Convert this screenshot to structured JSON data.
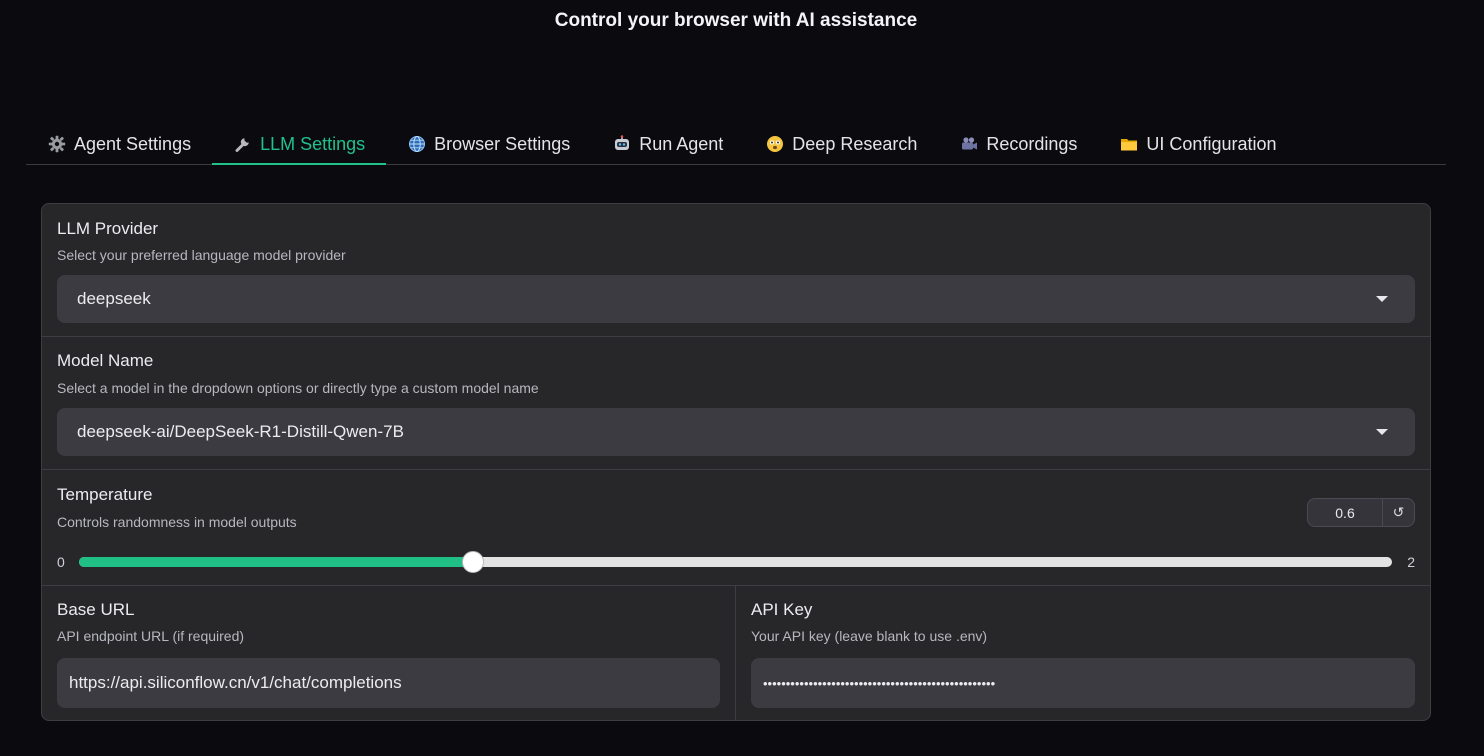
{
  "header": {
    "title": "Control your browser with AI assistance"
  },
  "tabs": [
    {
      "label": "Agent Settings",
      "icon": "gear-icon"
    },
    {
      "label": "LLM Settings",
      "icon": "wrench-icon",
      "active": true
    },
    {
      "label": "Browser Settings",
      "icon": "globe-icon"
    },
    {
      "label": "Run Agent",
      "icon": "robot-icon"
    },
    {
      "label": "Deep Research",
      "icon": "face-icon"
    },
    {
      "label": "Recordings",
      "icon": "movie-camera-icon"
    },
    {
      "label": "UI Configuration",
      "icon": "folder-icon"
    }
  ],
  "llm_provider": {
    "label": "LLM Provider",
    "info": "Select your preferred language model provider",
    "value": "deepseek"
  },
  "model_name": {
    "label": "Model Name",
    "info": "Select a model in the dropdown options or directly type a custom model name",
    "value": "deepseek-ai/DeepSeek-R1-Distill-Qwen-7B"
  },
  "temperature": {
    "label": "Temperature",
    "info": "Controls randomness in model outputs",
    "value": "0.6",
    "min": "0",
    "max": "2",
    "reset_icon": "↺"
  },
  "base_url": {
    "label": "Base URL",
    "info": "API endpoint URL (if required)",
    "value": "https://api.siliconflow.cn/v1/chat/completions"
  },
  "api_key": {
    "label": "API Key",
    "info": "Your API key (leave blank to use .env)",
    "value": "•••••••••••••••••••••••••••••••••••••••••••••••••••"
  },
  "colors": {
    "accent": "#21c18a",
    "background": "#0b0b0f",
    "panel": "#27272a",
    "field": "#3b3b41"
  }
}
